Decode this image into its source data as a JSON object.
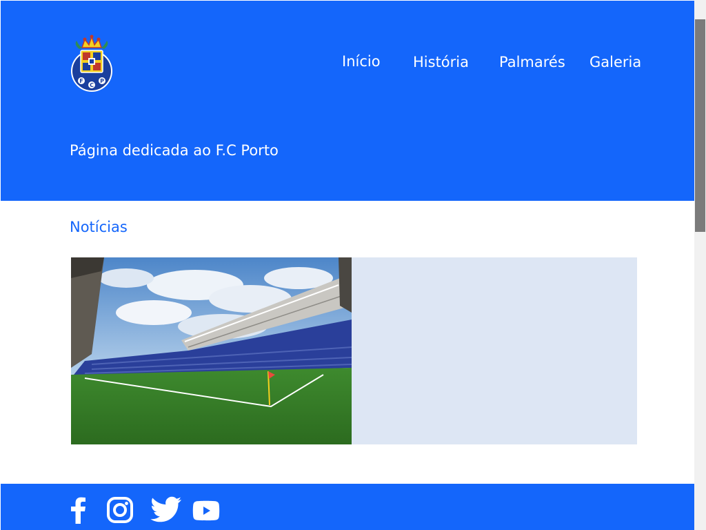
{
  "header": {
    "logo_alt": "F.C Porto",
    "nav": [
      "Início",
      "História",
      "Palmarés",
      "Galeria"
    ],
    "tagline": "Página dedicada ao F.C Porto"
  },
  "main": {
    "section_title": "Notícias",
    "news_image_alt": "Estádio do Dragão"
  },
  "footer": {
    "social": [
      "facebook-icon",
      "instagram-icon",
      "twitter-icon",
      "youtube-icon"
    ]
  },
  "colors": {
    "brand_blue": "#1466fb",
    "card_background": "#dde6f4",
    "text_white": "#ffffff"
  }
}
